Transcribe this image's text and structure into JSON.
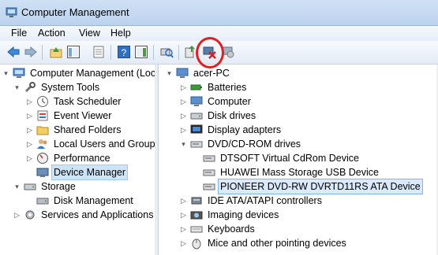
{
  "window": {
    "title": "Computer Management"
  },
  "menu": [
    "File",
    "Action",
    "View",
    "Help"
  ],
  "left_tree": [
    {
      "label": "Computer Management (Local",
      "expander": "▾",
      "icon": "computer-management-icon"
    },
    {
      "label": "System Tools",
      "expander": "▾",
      "icon": "tools-icon"
    },
    {
      "label": "Task Scheduler",
      "expander": "▷",
      "icon": "clock-icon"
    },
    {
      "label": "Event Viewer",
      "expander": "▷",
      "icon": "event-viewer-icon"
    },
    {
      "label": "Shared Folders",
      "expander": "▷",
      "icon": "shared-folder-icon"
    },
    {
      "label": "Local Users and Groups",
      "expander": "▷",
      "icon": "users-icon"
    },
    {
      "label": "Performance",
      "expander": "▷",
      "icon": "performance-icon"
    },
    {
      "label": "Device Manager",
      "expander": "",
      "icon": "device-manager-icon"
    },
    {
      "label": "Storage",
      "expander": "▾",
      "icon": "storage-icon"
    },
    {
      "label": "Disk Management",
      "expander": "",
      "icon": "disk-management-icon"
    },
    {
      "label": "Services and Applications",
      "expander": "▷",
      "icon": "services-icon"
    }
  ],
  "right_tree": [
    {
      "label": "acer-PC",
      "expander": "▾",
      "icon": "computer-icon"
    },
    {
      "label": "Batteries",
      "expander": "▷",
      "icon": "battery-icon"
    },
    {
      "label": "Computer",
      "expander": "▷",
      "icon": "computer-icon"
    },
    {
      "label": "Disk drives",
      "expander": "▷",
      "icon": "disk-drive-icon"
    },
    {
      "label": "Display adapters",
      "expander": "▷",
      "icon": "display-adapter-icon"
    },
    {
      "label": "DVD/CD-ROM drives",
      "expander": "▾",
      "icon": "dvd-drive-icon"
    },
    {
      "label": "DTSOFT Virtual CdRom Device",
      "expander": "",
      "icon": "dvd-device-icon"
    },
    {
      "label": "HUAWEI Mass Storage USB Device",
      "expander": "",
      "icon": "dvd-device-icon"
    },
    {
      "label": "PIONEER DVD-RW DVRTD11RS ATA Device",
      "expander": "",
      "icon": "dvd-device-icon"
    },
    {
      "label": "IDE ATA/ATAPI controllers",
      "expander": "▷",
      "icon": "ide-controller-icon"
    },
    {
      "label": "Imaging devices",
      "expander": "▷",
      "icon": "imaging-icon"
    },
    {
      "label": "Keyboards",
      "expander": "▷",
      "icon": "keyboard-icon"
    },
    {
      "label": "Mice and other pointing devices",
      "expander": "▷",
      "icon": "mouse-icon"
    }
  ],
  "colors": {
    "annotation": "#e02020",
    "selection": "#cce4f7"
  }
}
